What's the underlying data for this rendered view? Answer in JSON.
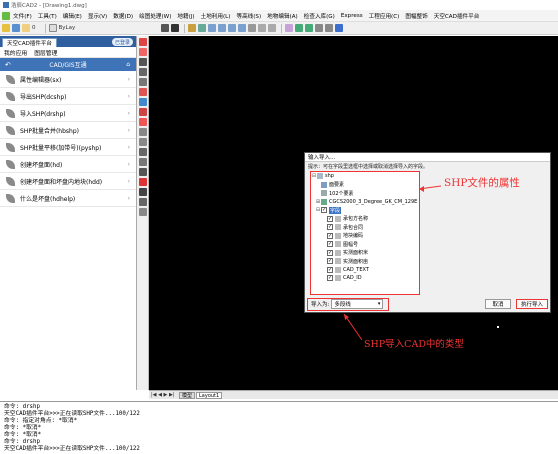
{
  "window": {
    "title": "浩辰CAD2 - [Drawing1.dwg]"
  },
  "menu": [
    "文件(F)",
    "工具(T)",
    "编辑(E)",
    "显示(V)",
    "数据(D)",
    "绘图处理(W)",
    "地籍(J)",
    "土地利用(L)",
    "等高线(S)",
    "地物编辑(A)",
    "检查入库(G)",
    "Express",
    "工程应用(C)",
    "图幅整饰",
    "天空CAD插件平台"
  ],
  "toolbar": {
    "layer": "0",
    "layer_style": "ByLay"
  },
  "panel": {
    "tab": "天空CAD插件平台",
    "login": "已登录",
    "subtabs": [
      "我的应用",
      "图层管理"
    ],
    "header": "CAD/GIS互通",
    "items": [
      "属性编辑器(sx)",
      "导出SHP(dcshp)",
      "导入SHP(drshp)",
      "SHP批量合并(hbshp)",
      "SHP批量平移(加带号)(pyshp)",
      "创建坏盘面(hd)",
      "创建坏盘面和坏盘内地块(hdd)",
      "什么是坏盘(hdhelp)"
    ]
  },
  "layout_tabs": [
    "模型",
    "Layout1"
  ],
  "dialog": {
    "title": "输入导入...",
    "hint": "提示：可在字段里选框中选择或取消选择导入的字段。",
    "tree": {
      "root": "shp",
      "children": [
        "面要素",
        "102个要素"
      ],
      "crs": "CGCS2000_3_Degree_GK_CM_129E",
      "fields_group": "字段",
      "fields": [
        "承包方名称",
        "承包合同",
        "地块编码",
        "图幅号",
        "实测面积米",
        "实测面积亩",
        "CAD_TEXT",
        "CAD_ID"
      ]
    },
    "import_label": "导入为:",
    "import_value": "多段线",
    "cancel": "取消",
    "execute": "执行导入"
  },
  "annotations": {
    "attr": "SHP文件的属性",
    "type": "SHP导入CAD中的类型"
  },
  "command": [
    "命令: drshp",
    "天空CAD插件平台>>>正在读取SHP文件...100/122",
    "命令: 指定对角点: *取消*",
    "命令: *取消*",
    "命令: *取消*",
    "命令: drshp",
    "天空CAD插件平台>>>正在读取SHP文件...100/122"
  ],
  "colors": {
    "panel_blue": "#3e73b8",
    "highlight": "#e33333",
    "canvas": "#000000"
  }
}
